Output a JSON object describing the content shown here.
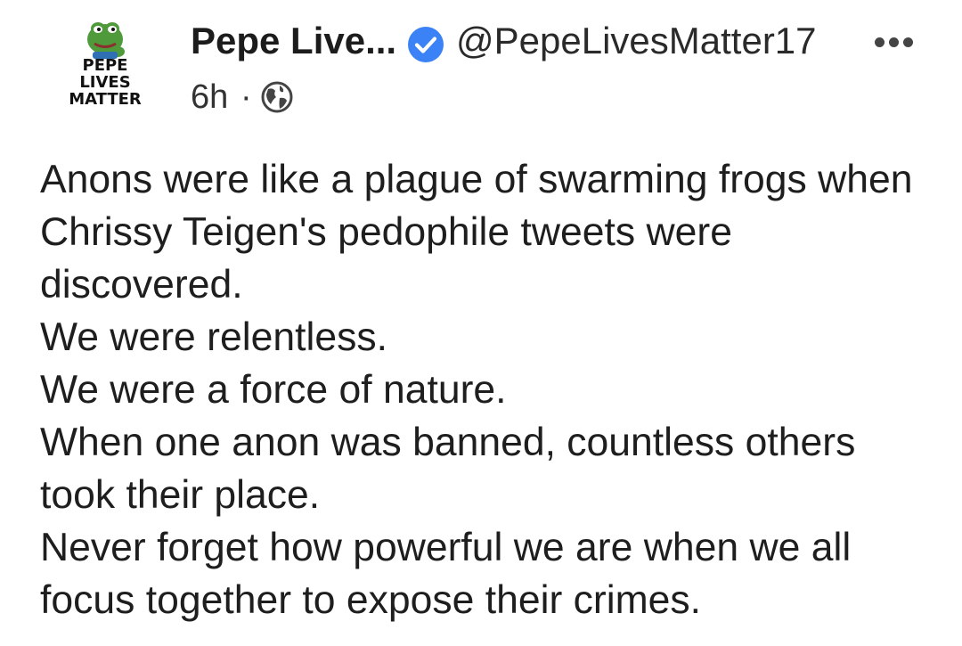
{
  "post": {
    "author_name": "Pepe Live...",
    "handle": "@PepeLivesMatter17",
    "time": "6h",
    "separator": "·",
    "verified_color": "#3b82f6",
    "avatar": {
      "line1": "PEPE",
      "line2": "LIVES",
      "line3": "MATTER",
      "icon": "pepe-frog-logo"
    },
    "icons": {
      "verified": "verified-check-icon",
      "visibility": "globe-icon",
      "more": "more-options-icon"
    },
    "paragraphs": [
      "Anons were like a plague of swarming frogs when Chrissy Teigen's pedophile tweets were discovered.",
      "We were relentless.",
      "We were a force of nature.",
      "When one anon was banned, countless others took their place.",
      "Never forget how powerful we are when we all focus together to expose their crimes."
    ]
  }
}
